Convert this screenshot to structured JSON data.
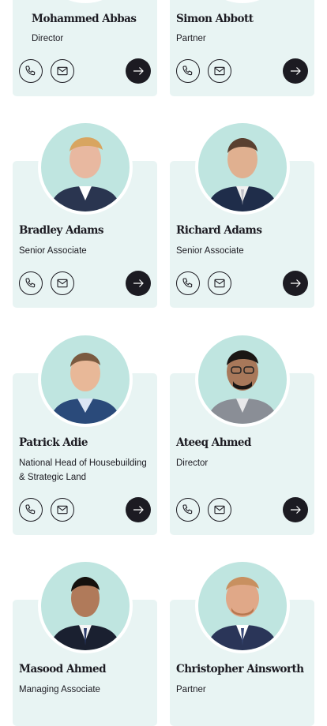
{
  "people": [
    {
      "name": "Mohammed Abbas",
      "role": "Director"
    },
    {
      "name": "Simon Abbott",
      "role": "Partner"
    },
    {
      "name": "Bradley Adams",
      "role": "Senior Associate"
    },
    {
      "name": "Richard Adams",
      "role": "Senior Associate"
    },
    {
      "name": "Patrick Adie",
      "role": "National Head of Housebuilding & Strategic Land"
    },
    {
      "name": "Ateeq Ahmed",
      "role": "Director"
    },
    {
      "name": "Masood Ahmed",
      "role": "Managing Associate"
    },
    {
      "name": "Christopher Ainsworth",
      "role": "Partner"
    }
  ],
  "icons": {
    "phone": "phone-icon",
    "email": "mail-icon",
    "profile": "arrow-right-icon"
  },
  "colors": {
    "card_bg": "#e8f4f3",
    "ink": "#1c1b22",
    "photo_bg": "#bfe5e0"
  }
}
